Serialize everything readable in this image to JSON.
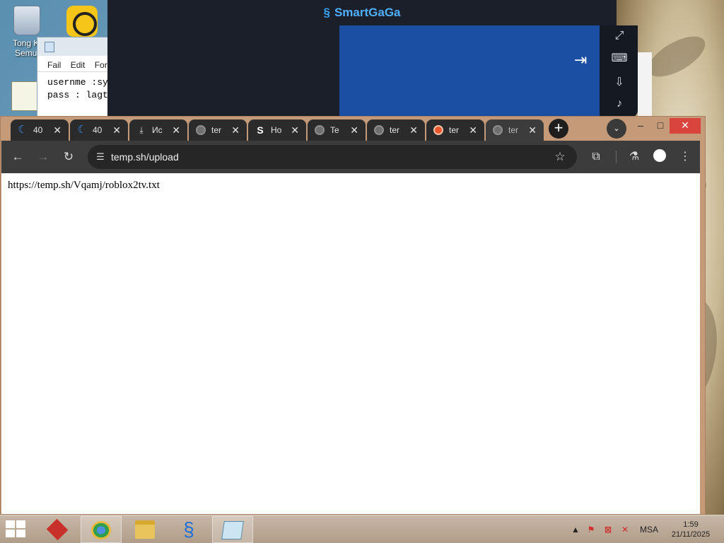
{
  "desktop": {
    "icons": [
      {
        "label": "Tong Ki\nSemul",
        "name": "recycle-bin"
      },
      {
        "label": "",
        "name": "ldplayer"
      },
      {
        "label": "",
        "name": "notes"
      }
    ]
  },
  "notepad": {
    "menu": [
      "Fail",
      "Edit",
      "For"
    ],
    "lines": [
      "usernme :sy",
      "pass : lagt"
    ]
  },
  "emulator": {
    "title": "SmartGaGa"
  },
  "chrome": {
    "tabs": [
      {
        "label": "40",
        "favicon": "moon"
      },
      {
        "label": "40",
        "favicon": "moon"
      },
      {
        "label": "Ис",
        "favicon": "download"
      },
      {
        "label": "ter",
        "favicon": "globe"
      },
      {
        "label": "Ho",
        "favicon": "s"
      },
      {
        "label": "Te",
        "favicon": "globe"
      },
      {
        "label": "ter",
        "favicon": "globe"
      },
      {
        "label": "ter",
        "favicon": "orange"
      },
      {
        "label": "ter",
        "favicon": "globe",
        "active": true
      }
    ],
    "url": "temp.sh/upload",
    "page_text": "https://temp.sh/Vqamj/roblox2tv.txt"
  },
  "taskbar": {
    "language": "MSA",
    "time": "1:59",
    "date": "21/11/2025"
  }
}
